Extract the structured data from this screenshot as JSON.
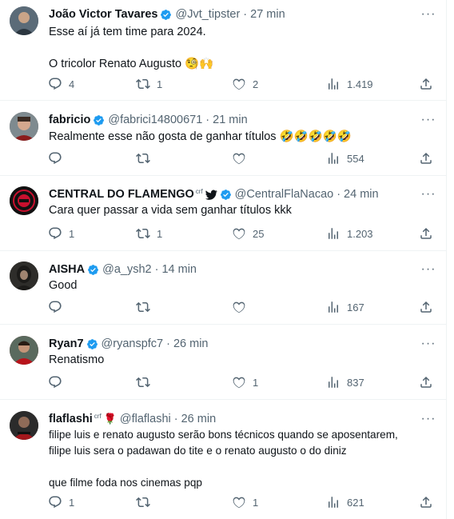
{
  "tweets": [
    {
      "name": "João Victor Tavares",
      "verified": true,
      "handle": "@Jvt_tipster",
      "sep": "·",
      "time": "27 min",
      "text": "Esse aí já tem time para 2024.\n\nO tricolor Renato Augusto 🧐🙌",
      "replies": "4",
      "retweets": "1",
      "likes": "2",
      "views": "1.419",
      "avatar_color": "#4a5560"
    },
    {
      "name": "fabricio",
      "verified": true,
      "handle": "@fabrici14800671",
      "sep": "·",
      "time": "21 min",
      "text": "Realmente esse não gosta de ganhar títulos 🤣🤣🤣🤣🤣",
      "replies": "",
      "retweets": "",
      "likes": "",
      "views": "554",
      "avatar_color": "#6b5b55"
    },
    {
      "name": "CENTRAL DO FLAMENGO",
      "tag": "crf",
      "verified": true,
      "handle": "@CentralFlaNacao",
      "sep": "·",
      "time": "24 min",
      "text": "Cara quer passar a vida sem ganhar títulos kkk",
      "replies": "1",
      "retweets": "1",
      "likes": "25",
      "views": "1.203",
      "avatar_color": "#1a1a1a"
    },
    {
      "name": "AISHA",
      "verified": true,
      "handle": "@a_ysh2",
      "sep": "·",
      "time": "14 min",
      "text": "Good",
      "replies": "",
      "retweets": "",
      "likes": "",
      "views": "167",
      "avatar_color": "#3a3a38"
    },
    {
      "name": "Ryan7",
      "verified": true,
      "handle": "@ryanspfc7",
      "sep": "·",
      "time": "26 min",
      "text": "Renatismo",
      "replies": "",
      "retweets": "",
      "likes": "1",
      "views": "837",
      "avatar_color": "#7a2a2a"
    },
    {
      "name": "flaflashi",
      "tag": "crf",
      "rose": "🌹",
      "verified": false,
      "handle": "@flaflashi",
      "sep": "·",
      "time": "26 min",
      "text": "filipe luis e renato augusto serão bons técnicos quando se aposentarem,\nfilipe luis sera o padawan do tite e o renato augusto o do diniz\n\nque filme foda nos cinemas pqp",
      "replies": "1",
      "retweets": "",
      "likes": "1",
      "views": "621",
      "avatar_color": "#2d2d2d"
    }
  ],
  "icons": {
    "reply": "reply-icon",
    "retweet": "retweet-icon",
    "like": "heart-icon",
    "views": "views-icon",
    "share": "share-icon",
    "more": "more-icon",
    "verified": "verified-badge-icon",
    "twitter": "twitter-bird-icon"
  },
  "colors": {
    "muted": "#536471",
    "text": "#0f1419",
    "verified": "#1d9bf0",
    "divider": "#eff3f4"
  }
}
